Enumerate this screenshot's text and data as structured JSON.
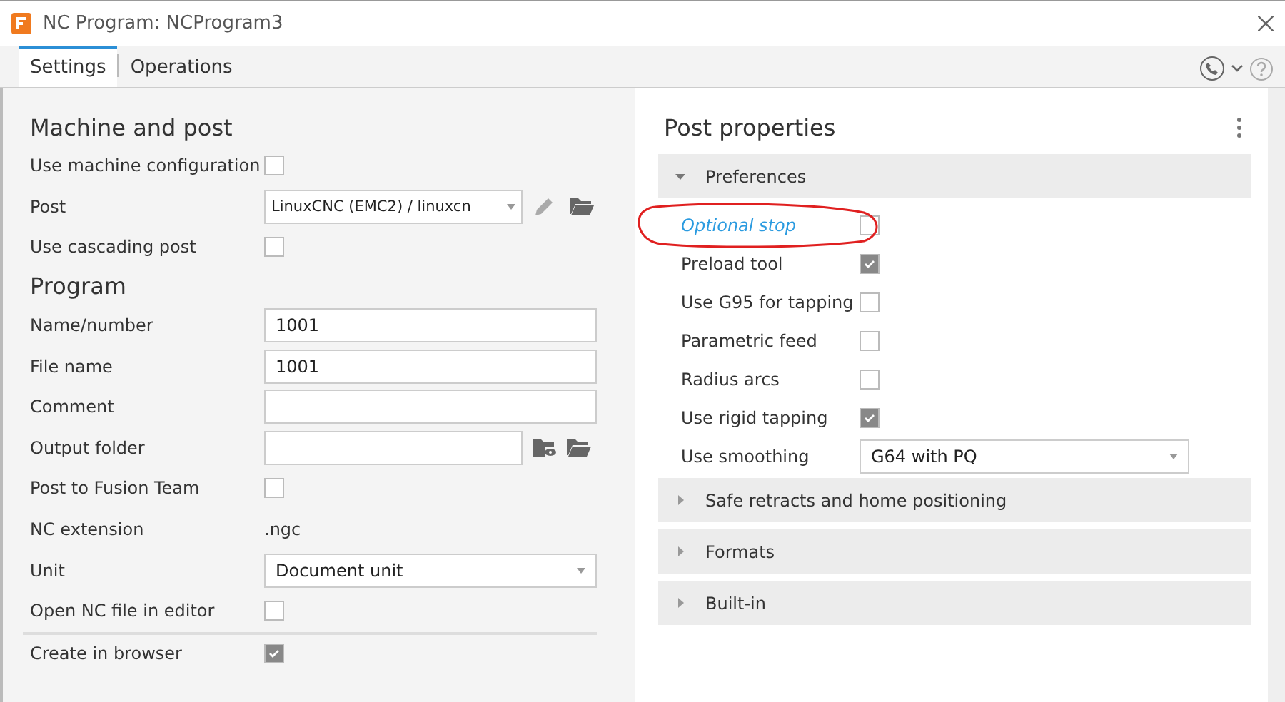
{
  "window": {
    "title": "NC Program: NCProgram3"
  },
  "tabs": [
    {
      "label": "Settings",
      "selected": true
    },
    {
      "label": "Operations",
      "selected": false
    }
  ],
  "left_sections": [
    {
      "heading": "Machine and post",
      "rows": [
        {
          "kind": "checkbox",
          "label": "Use machine configuration",
          "checked": false
        },
        {
          "kind": "post-select",
          "label": "Post",
          "value": "LinuxCNC (EMC2) / linuxcn"
        },
        {
          "kind": "checkbox",
          "label": "Use cascading post",
          "checked": false
        }
      ]
    },
    {
      "heading": "Program",
      "rows": [
        {
          "kind": "input",
          "label": "Name/number",
          "value": "1001"
        },
        {
          "kind": "input",
          "label": "File name",
          "value": "1001"
        },
        {
          "kind": "input",
          "label": "Comment"
        },
        {
          "kind": "folder-input",
          "label": "Output folder"
        },
        {
          "kind": "checkbox",
          "label": "Post to Fusion Team",
          "checked": false
        },
        {
          "kind": "static",
          "label": "NC extension",
          "value": ".ngc"
        },
        {
          "kind": "select",
          "label": "Unit",
          "value": "Document unit"
        },
        {
          "kind": "checkbox",
          "label": "Open NC file in editor",
          "checked": false
        },
        {
          "kind": "checkbox",
          "label": "Create in browser",
          "checked": true,
          "divider_above": true
        }
      ]
    }
  ],
  "post_properties": {
    "heading": "Post properties",
    "groups": [
      {
        "title": "Preferences",
        "expanded": true,
        "rows": [
          {
            "kind": "checkbox",
            "label": "Optional stop",
            "checked": false,
            "modified": true,
            "circled": true
          },
          {
            "kind": "checkbox",
            "label": "Preload tool",
            "checked": true,
            "modified": false
          },
          {
            "kind": "checkbox",
            "label": "Use G95 for tapping",
            "checked": false,
            "modified": false
          },
          {
            "kind": "checkbox",
            "label": "Parametric feed",
            "checked": false,
            "modified": false
          },
          {
            "kind": "checkbox",
            "label": "Radius arcs",
            "checked": false,
            "modified": false
          },
          {
            "kind": "checkbox",
            "label": "Use rigid tapping",
            "checked": true,
            "modified": false
          },
          {
            "kind": "select",
            "label": "Use smoothing",
            "value": "G64 with PQ",
            "modified": false
          }
        ]
      },
      {
        "title": "Safe retracts and home positioning",
        "expanded": false
      },
      {
        "title": "Formats",
        "expanded": false
      },
      {
        "title": "Built-in",
        "expanded": false
      }
    ]
  }
}
